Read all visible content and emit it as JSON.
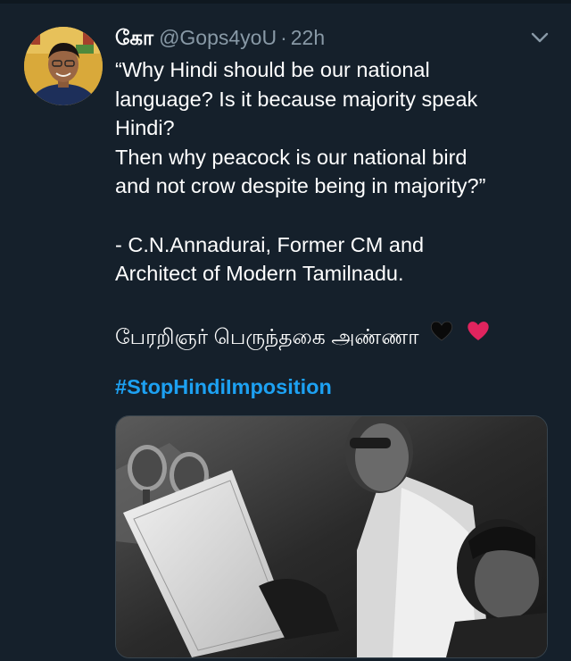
{
  "tweet": {
    "display_name": "கோ",
    "handle": "@Gops4yoU",
    "separator": "·",
    "time": "22h",
    "body_lines": [
      "“Why Hindi should be our national",
      "language? Is it because majority speak",
      "Hindi?",
      "Then why peacock is our national bird",
      "and not crow despite being in majority?”"
    ],
    "quote_lines": [
      "- C.N.Annadurai, Former CM and",
      "Architect of Modern  Tamilnadu."
    ],
    "tamil_line": "பேரறிஞர் பெருந்தகை அண்ணா",
    "hashtag": "#StopHindiImposition"
  },
  "icons": {
    "avatar": "avatar-photo",
    "caret": "chevron-down-icon",
    "heart_black": "black-heart-icon",
    "heart_red": "red-heart-icon",
    "media": "tweet-photo"
  },
  "colors": {
    "background": "#15202b",
    "text": "#ffffff",
    "secondary": "#8899a6",
    "link": "#1da1f2",
    "heart_red": "#e0245e"
  }
}
